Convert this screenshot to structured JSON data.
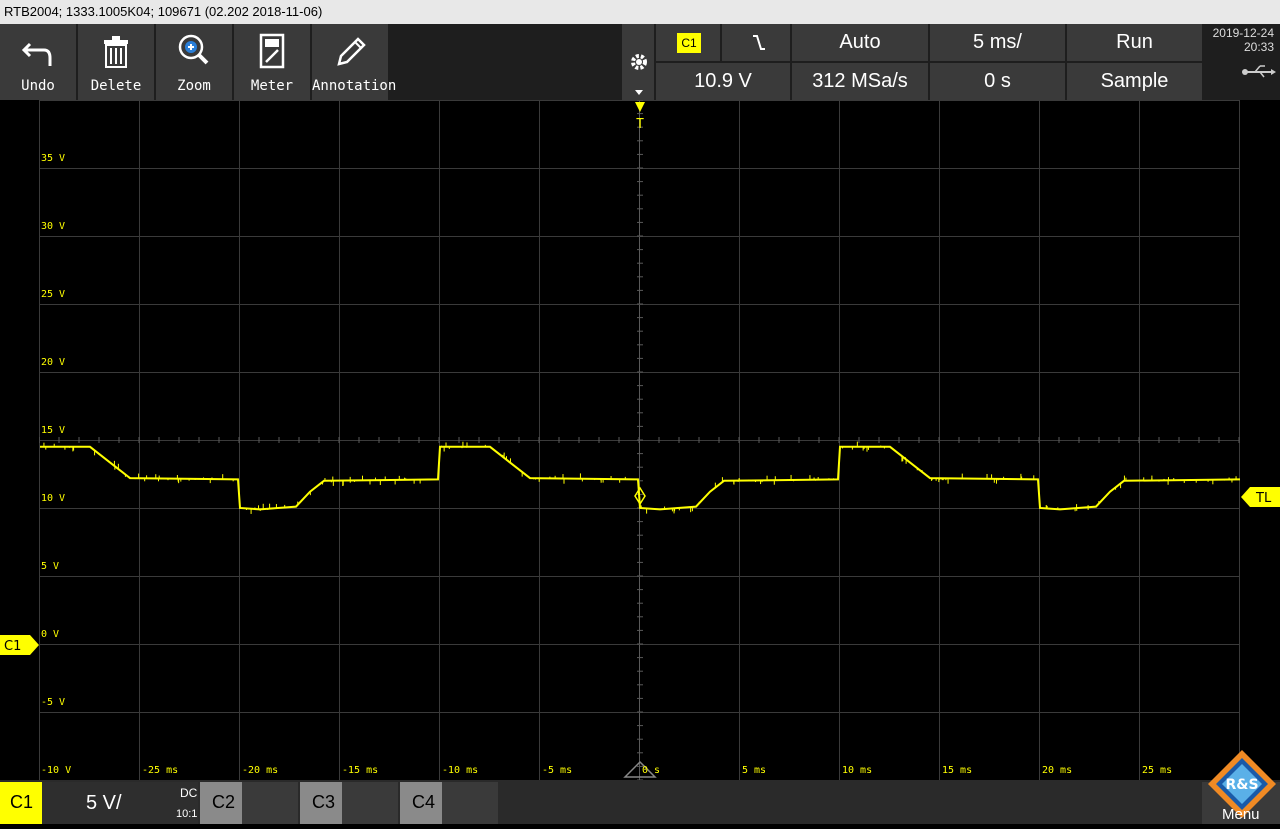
{
  "title_bar": "RTB2004; 1333.1005K04; 109671 (02.202 2018-11-06)",
  "toolbar": {
    "undo": "Undo",
    "delete": "Delete",
    "zoom": "Zoom",
    "meter": "Meter",
    "annotation": "Annotation"
  },
  "trigger": {
    "source": "C1",
    "slope_icon": "falling-edge-icon",
    "mode": "Auto",
    "timebase": "5 ms/",
    "run_state": "Run",
    "level": "10.9 V",
    "sample_rate": "312 MSa/s",
    "offset": "0 s",
    "acq_mode": "Sample"
  },
  "datetime": {
    "date": "2019-12-24",
    "time": "20:33"
  },
  "grid": {
    "y_labels": [
      "35 V",
      "30 V",
      "25 V",
      "20 V",
      "15 V",
      "10 V",
      "5 V",
      "0 V",
      "-5 V",
      "-10 V"
    ],
    "x_labels": [
      "-25 ms",
      "-20 ms",
      "-15 ms",
      "-10 ms",
      "-5 ms",
      "0 s",
      "5 ms",
      "10 ms",
      "15 ms",
      "20 ms",
      "25 ms"
    ]
  },
  "markers": {
    "trigger_top": "T",
    "channel": "C1",
    "trigger_level": "TL"
  },
  "bottom": {
    "c1": {
      "name": "C1",
      "scale": "5 V/",
      "coupling": "DC",
      "probe": "10:1"
    },
    "c2": "C2",
    "c3": "C3",
    "c4": "C4",
    "menu": "Menu",
    "logo": "R&S"
  },
  "colors": {
    "trace": "#ffff00",
    "grid": "#3a3a3a",
    "toolbar": "#3a3a3a"
  },
  "waveform": {
    "description_units": "time ms, voltage V",
    "period_ms": 20,
    "points": [
      [
        -30,
        14.5
      ],
      [
        -27.5,
        14.5
      ],
      [
        -26.2,
        13.0
      ],
      [
        -25.5,
        12.2
      ],
      [
        -20.1,
        12.1
      ],
      [
        -20,
        10.0
      ],
      [
        -19,
        9.9
      ],
      [
        -17.2,
        10.1
      ],
      [
        -16.5,
        11.2
      ],
      [
        -15.8,
        12.0
      ],
      [
        -10.1,
        12.1
      ],
      [
        -10,
        14.5
      ],
      [
        -7.5,
        14.5
      ],
      [
        -6.2,
        13.0
      ],
      [
        -5.5,
        12.2
      ],
      [
        -0.1,
        12.1
      ],
      [
        0,
        10.0
      ],
      [
        1,
        9.9
      ],
      [
        2.8,
        10.1
      ],
      [
        3.5,
        11.2
      ],
      [
        4.2,
        12.0
      ],
      [
        9.9,
        12.1
      ],
      [
        10,
        14.5
      ],
      [
        12.5,
        14.5
      ],
      [
        13.8,
        13.0
      ],
      [
        14.5,
        12.2
      ],
      [
        19.9,
        12.1
      ],
      [
        20,
        10.0
      ],
      [
        21,
        9.9
      ],
      [
        22.8,
        10.1
      ],
      [
        23.5,
        11.2
      ],
      [
        24.2,
        12.0
      ],
      [
        30,
        12.1
      ]
    ]
  }
}
